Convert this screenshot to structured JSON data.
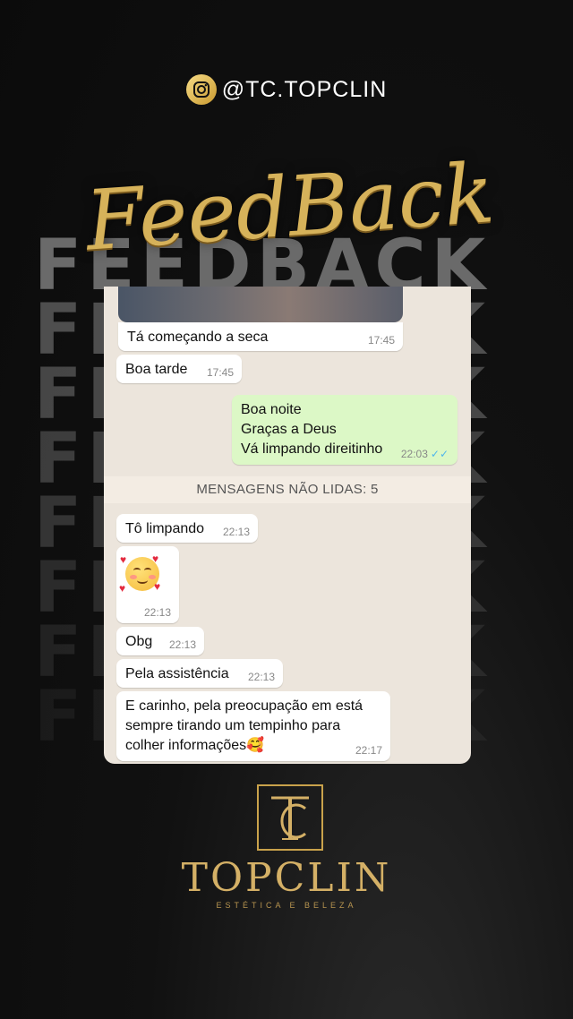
{
  "header": {
    "handle": "@TC.TOPCLIN",
    "icon": "instagram-icon"
  },
  "title": "FeedBack",
  "background_word": "FEEDBACK",
  "chat": {
    "unread_banner": "MENSAGENS NÃO LIDAS: 5",
    "messages": [
      {
        "lines": [
          "Tá começando a seca"
        ],
        "time": "17:45",
        "direction": "in"
      },
      {
        "lines": [
          "Boa tarde"
        ],
        "time": "17:45",
        "direction": "in"
      },
      {
        "lines": [
          "Boa noite",
          "Graças a Deus",
          "Vá limpando direitinho"
        ],
        "time": "22:03",
        "direction": "out",
        "status": "read"
      },
      {
        "lines": [
          "Tô limpando"
        ],
        "time": "22:13",
        "direction": "in"
      },
      {
        "lines": [
          "🥰"
        ],
        "time": "22:13",
        "direction": "in",
        "kind": "emoji"
      },
      {
        "lines": [
          "Obg"
        ],
        "time": "22:13",
        "direction": "in"
      },
      {
        "lines": [
          "Pela assistência"
        ],
        "time": "22:13",
        "direction": "in"
      },
      {
        "lines": [
          "E carinho, pela preocupação em está",
          "sempre tirando um tempinho para",
          "colher informações🥰"
        ],
        "time": "22:17",
        "direction": "in"
      }
    ]
  },
  "brand": {
    "name": "TOPCLIN",
    "tagline": "ESTÉTICA E BELEZA",
    "monogram": "TC"
  },
  "colors": {
    "gold": "#d4b066",
    "bubble_out": "#dcf8c6",
    "bubble_in": "#ffffff",
    "chat_bg": "#ece5dc"
  }
}
